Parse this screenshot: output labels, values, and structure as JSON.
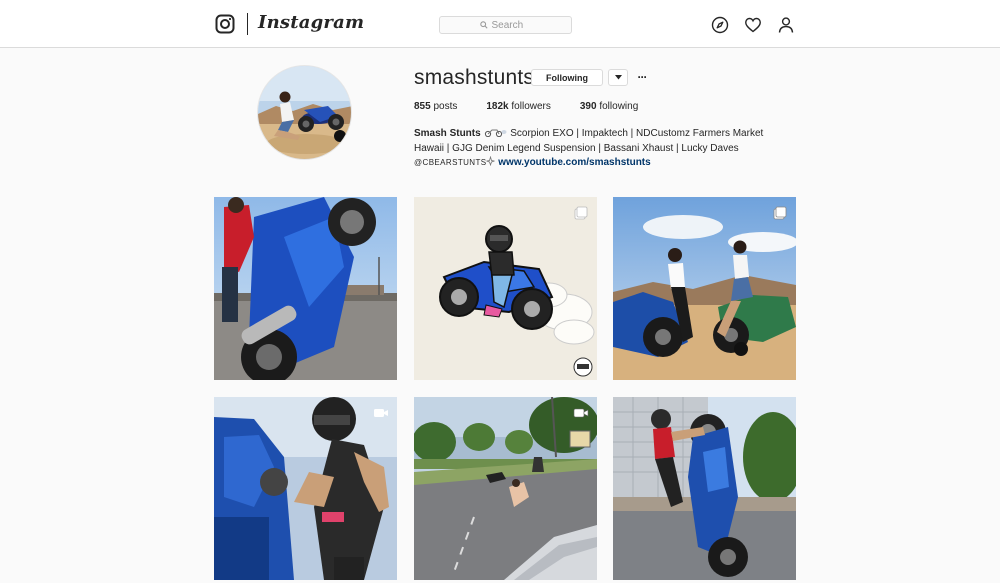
{
  "nav": {
    "logo_icon": "instagram-camera-icon",
    "wordmark": "Instagram",
    "search_placeholder": "Search",
    "icons": [
      "compass-icon",
      "heart-icon",
      "person-icon"
    ]
  },
  "profile": {
    "username": "smashstunts",
    "follow_label": "Following",
    "more_label": "···",
    "stats": {
      "posts_count": "855",
      "posts_label": "posts",
      "followers_count": "182k",
      "followers_label": "followers",
      "following_count": "390",
      "following_label": "following"
    },
    "bio": {
      "full_name": "Smash Stunts",
      "line1_rest": "Scorpion EXO | Impaktech | NDCustomz Farmers Market",
      "line2": "Hawaii | GJG Denim Legend Suspension | Bassani Xhaust | Lucky Daves",
      "handle": "@CBEARSTUNTS",
      "link": "www.youtube.com/smashstunts"
    }
  },
  "posts": [
    {
      "type": "photo"
    },
    {
      "type": "carousel",
      "badge_icon": "carousel-icon"
    },
    {
      "type": "carousel",
      "badge_icon": "carousel-icon"
    },
    {
      "type": "video",
      "badge_icon": "video-camera-icon"
    },
    {
      "type": "video",
      "badge_icon": "video-camera-icon"
    },
    {
      "type": "photo"
    }
  ],
  "colors": {
    "background": "#fafafa",
    "nav_background": "#ffffff",
    "border": "#dbdbdb",
    "text": "#262626",
    "link": "#003569"
  }
}
